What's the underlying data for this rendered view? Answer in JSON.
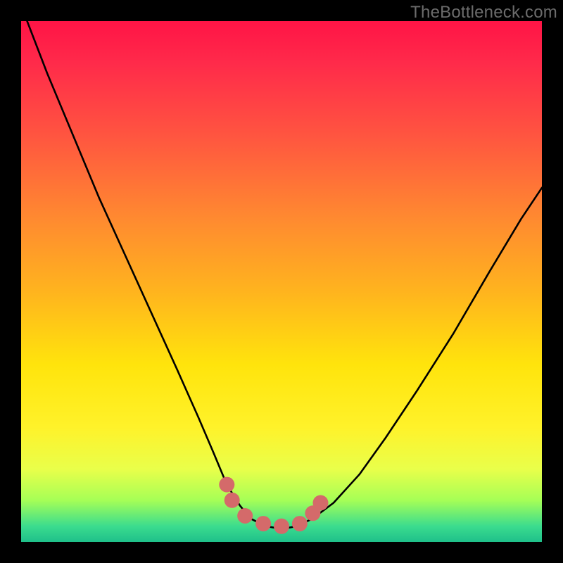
{
  "watermark": "TheBottleneck.com",
  "chart_data": {
    "type": "line",
    "title": "",
    "xlabel": "",
    "ylabel": "",
    "xlim": [
      0,
      1
    ],
    "ylim": [
      0,
      1
    ],
    "series": [
      {
        "name": "bottleneck-curve",
        "x": [
          0.0,
          0.05,
          0.1,
          0.15,
          0.2,
          0.25,
          0.3,
          0.34,
          0.37,
          0.395,
          0.42,
          0.44,
          0.47,
          0.5,
          0.53,
          0.56,
          0.6,
          0.65,
          0.7,
          0.76,
          0.83,
          0.9,
          0.96,
          1.0
        ],
        "y": [
          1.03,
          0.9,
          0.78,
          0.66,
          0.55,
          0.44,
          0.33,
          0.24,
          0.17,
          0.11,
          0.07,
          0.045,
          0.03,
          0.025,
          0.03,
          0.045,
          0.075,
          0.13,
          0.2,
          0.29,
          0.4,
          0.52,
          0.62,
          0.68
        ]
      },
      {
        "name": "marker-dots",
        "x": [
          0.395,
          0.405,
          0.43,
          0.465,
          0.5,
          0.535,
          0.56,
          0.575
        ],
        "y": [
          0.11,
          0.08,
          0.05,
          0.035,
          0.03,
          0.035,
          0.055,
          0.075
        ]
      }
    ],
    "colors": {
      "curve": "#000000",
      "dots": "#d46a6a"
    }
  }
}
